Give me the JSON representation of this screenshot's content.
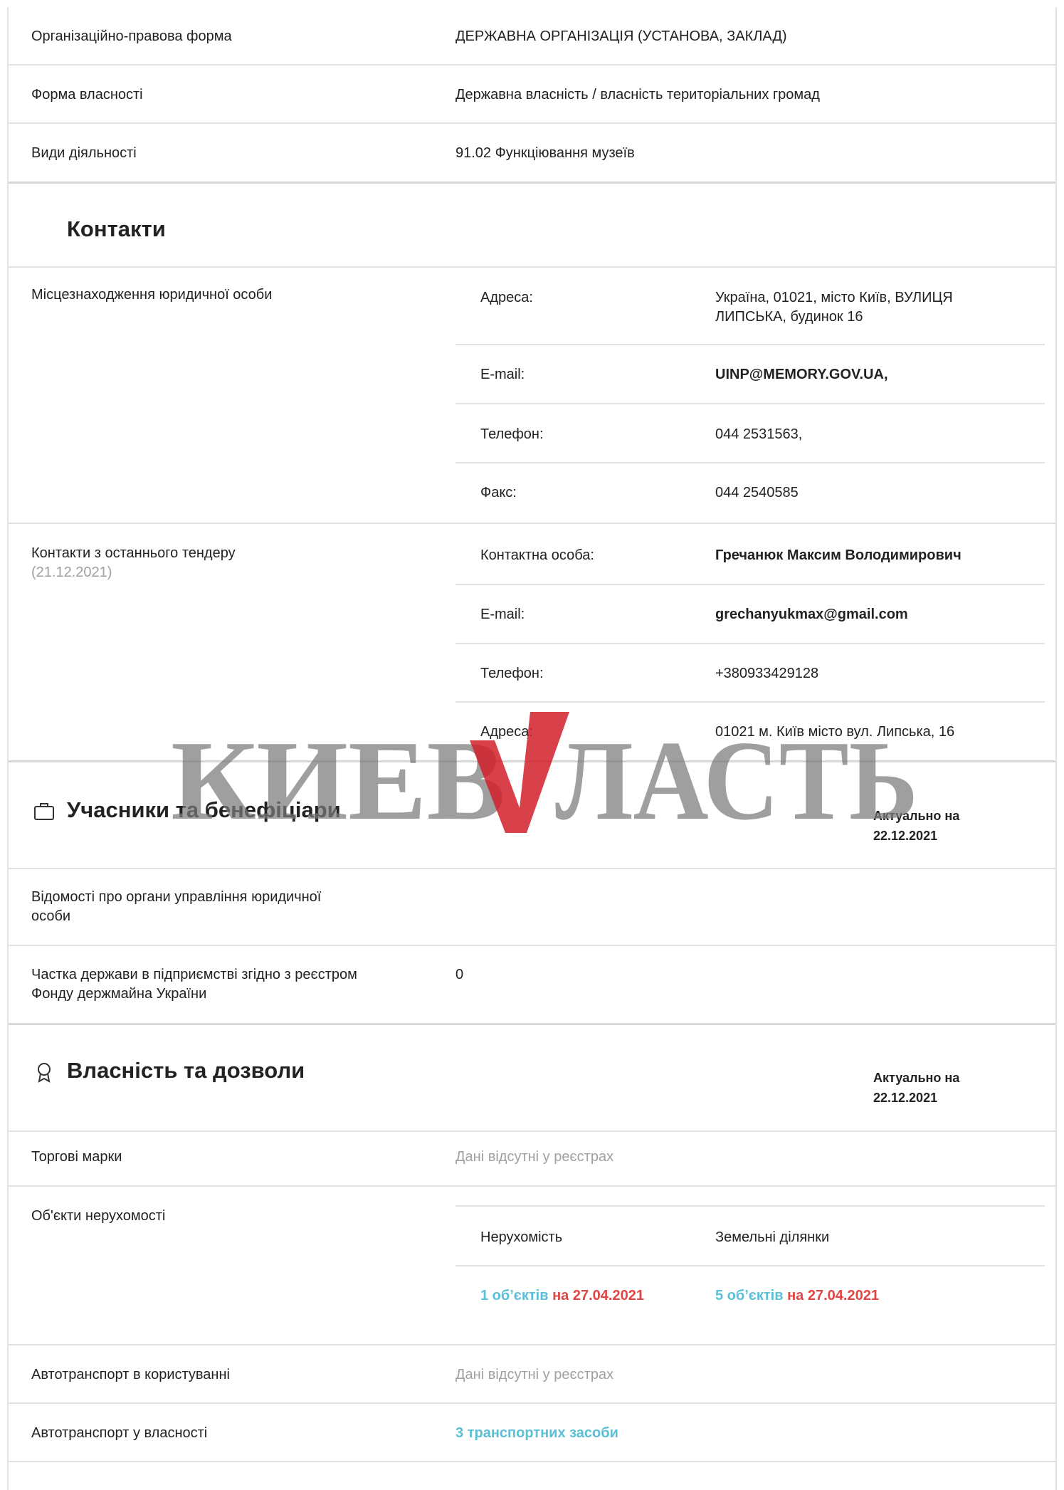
{
  "info": {
    "org_form_label": "Організаційно-правова форма",
    "org_form_value": "ДЕРЖАВНА ОРГАНІЗАЦІЯ (УСТАНОВА, ЗАКЛАД)",
    "ownership_label": "Форма власності",
    "ownership_value": "Державна власність / власність територіальних громад",
    "activity_label": "Види діяльності",
    "activity_value": "91.02 Функціювання музеїв"
  },
  "contacts": {
    "title": "Контакти",
    "location_label": "Місцезнаходження юридичної особи",
    "address_key": "Адреса:",
    "address_value_line1": "Україна, 01021, місто Київ, ВУЛИЦЯ",
    "address_value_line2": "ЛИПСЬКА, будинок 16",
    "email_key": "E-mail:",
    "email_value": "UINP@MEMORY.GOV.UA,",
    "phone_key": "Телефон:",
    "phone_value": "044 2531563,",
    "fax_key": "Факс:",
    "fax_value": "044 2540585",
    "tender_label": "Контакти з останнього тендеру",
    "tender_date": "(21.12.2021)",
    "person_key": "Контактна особа:",
    "person_value": "Гречанюк Максим Володимирович",
    "tender_email_key": "E-mail:",
    "tender_email_value": "grechanyukmax@gmail.com",
    "tender_phone_key": "Телефон:",
    "tender_phone_value": "+380933429128",
    "tender_address_key": "Адреса:",
    "tender_address_value": "01021 м. Київ місто вул. Липська, 16"
  },
  "participants": {
    "title": "Учасники та бенефіціари",
    "actual_label": "Актуально на",
    "actual_date": "22.12.2021",
    "mgmt_label_line1": "Відомості про органи управління юридичної",
    "mgmt_label_line2": "особи",
    "share_label_line1": "Частка держави в підприємстві згідно з реєстром",
    "share_label_line2": "Фонду держмайна України",
    "share_value": "0"
  },
  "property": {
    "title": "Власність та дозволи",
    "actual_label": "Актуально на",
    "actual_date": "22.12.2021",
    "trademarks_label": "Торгові марки",
    "trademarks_value": "Дані відсутні у реєстрах",
    "realty_label": "Об'єкти нерухомості",
    "realty_col1": "Нерухомість",
    "realty_col2": "Земельні ділянки",
    "realty_count1": "1 об’єктів",
    "realty_on1": "на 27.04.2021",
    "realty_count2": "5 об’єктів",
    "realty_on2": "на 27.04.2021",
    "vehicles_use_label": "Автотранспорт в користуванні",
    "vehicles_use_value": "Дані відсутні у реєстрах",
    "vehicles_own_label": "Автотранспорт у власності",
    "vehicles_own_value": "3 транспортних засоби"
  },
  "watermark": {
    "text": "КИЕВ ЛАСТЬ",
    "color_text": "#7a7a7a",
    "color_accent": "#d2202a"
  },
  "colors": {
    "link": "#5bbfd6",
    "accent_red": "#e04545",
    "muted": "#a0a0a0"
  }
}
